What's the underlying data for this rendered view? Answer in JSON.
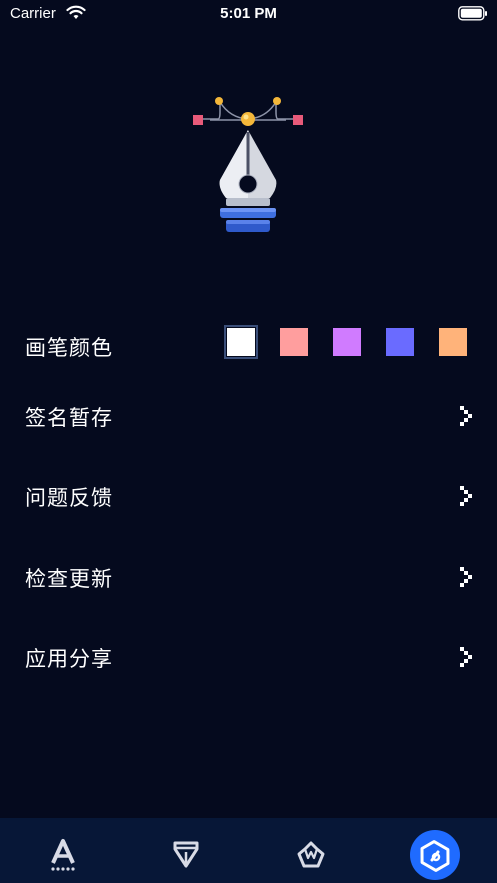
{
  "status_bar": {
    "carrier": "Carrier",
    "time": "5:01 PM"
  },
  "hero": {
    "icon": "pen-nib-bezier-icon"
  },
  "settings": {
    "pen_color": {
      "label": "画笔颜色",
      "options": [
        "#ffffff",
        "#ff9e9e",
        "#d07bff",
        "#6a6bff",
        "#ffb37a"
      ],
      "selected_index": 0
    },
    "items": [
      {
        "label": "签名暂存"
      },
      {
        "label": "问题反馈"
      },
      {
        "label": "检查更新"
      },
      {
        "label": "应用分享"
      }
    ]
  },
  "tab_bar": {
    "tabs": [
      {
        "icon": "text-a-icon",
        "active": false
      },
      {
        "icon": "pen-nib-icon",
        "active": false
      },
      {
        "icon": "crown-icon",
        "active": false
      },
      {
        "icon": "settings-hex-icon",
        "active": true
      }
    ],
    "active_color": "#1f6bff"
  },
  "colors": {
    "background": "#050a1e",
    "tab_bar": "#071737"
  }
}
